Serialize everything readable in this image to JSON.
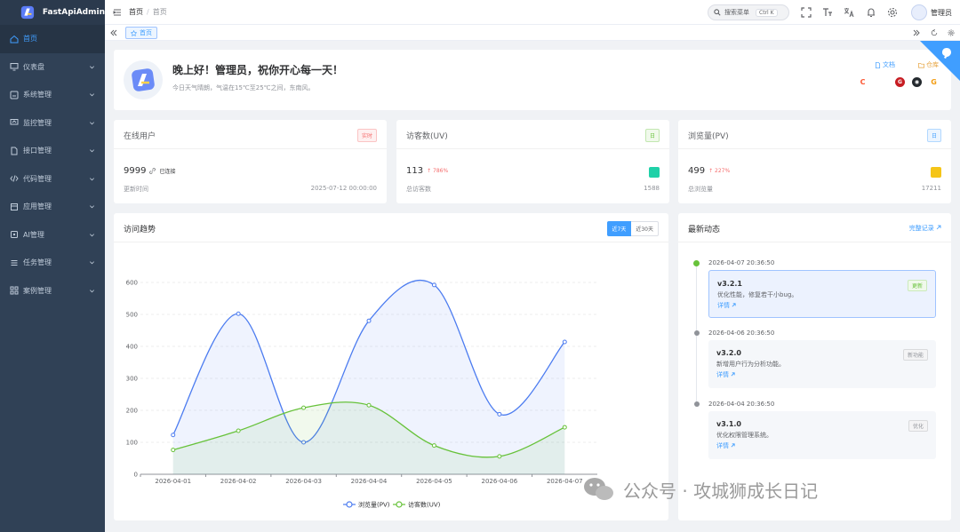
{
  "app": {
    "name": "FastApiAdmin"
  },
  "sidebar": {
    "items": [
      {
        "label": "首页",
        "icon": "home-icon",
        "active": true
      },
      {
        "label": "仪表盘",
        "icon": "monitor-icon"
      },
      {
        "label": "系统管理",
        "icon": "system-icon"
      },
      {
        "label": "监控管理",
        "icon": "monitor-chart-icon"
      },
      {
        "label": "接口管理",
        "icon": "api-doc-icon"
      },
      {
        "label": "代码管理",
        "icon": "code-icon"
      },
      {
        "label": "应用管理",
        "icon": "app-icon"
      },
      {
        "label": "AI管理",
        "icon": "ai-icon"
      },
      {
        "label": "任务管理",
        "icon": "task-icon"
      },
      {
        "label": "案例管理",
        "icon": "grid-icon"
      }
    ]
  },
  "header": {
    "breadcrumb": [
      "首页",
      "首页"
    ],
    "breadcrumb_sep": "/",
    "search_placeholder": "搜索菜单",
    "shortcut": "Ctrl K",
    "user_name": "管理员"
  },
  "tabs": [
    {
      "label": "首页"
    }
  ],
  "welcome": {
    "title": "晚上好！管理员，祝你开心每一天！",
    "subtitle": "今日天气晴朗，气温在15℃至25℃之间，东南风。",
    "doc_link": "文档",
    "repo_link": "仓库"
  },
  "stats": [
    {
      "title": "在线用户",
      "badge": "实时",
      "badge_color": "#f56c6c",
      "value": "9999",
      "extra": "已连接",
      "foot_label": "更新时间",
      "foot_value": "2025-07-12 00:00:00"
    },
    {
      "title": "访客数(UV)",
      "badge": "日",
      "badge_color": "#67c23a",
      "value": "113",
      "extra": "↑ 786%",
      "foot_label": "总访客数",
      "foot_value": "1588"
    },
    {
      "title": "浏览量(PV)",
      "badge": "日",
      "badge_color": "#409eff",
      "value": "499",
      "extra": "↑ 227%",
      "foot_label": "总浏览量",
      "foot_value": "17211"
    }
  ],
  "trend": {
    "title": "访问趋势",
    "range_options": [
      "近7天",
      "近30天"
    ],
    "selected": "近7天"
  },
  "chart_data": {
    "type": "line",
    "x": [
      "2026-04-01",
      "2026-04-02",
      "2026-04-03",
      "2026-04-04",
      "2026-04-05",
      "2026-04-06",
      "2026-04-07"
    ],
    "series": [
      {
        "name": "浏览量(PV)",
        "values": [
          123,
          502,
          100,
          480,
          592,
          188,
          414
        ],
        "color": "#4c7cf0"
      },
      {
        "name": "访客数(UV)",
        "values": [
          76,
          136,
          208,
          216,
          90,
          56,
          147
        ],
        "color": "#67c23a"
      }
    ],
    "ylim": [
      0,
      600
    ],
    "yticks": [
      0,
      100,
      200,
      300,
      400,
      500,
      600
    ],
    "smooth": true,
    "area": true,
    "grid": true,
    "legend": "bottom"
  },
  "news": {
    "title": "最新动态",
    "more": "完整记录",
    "items": [
      {
        "date": "2026-04-07 20:36:50",
        "version": "v3.2.1",
        "desc": "优化性能，修复若干小bug。",
        "link": "详情",
        "badge": "更新",
        "dot_color": "#67c23a",
        "highlight": true
      },
      {
        "date": "2026-04-06 20:36:50",
        "version": "v3.2.0",
        "desc": "新增用户行为分析功能。",
        "link": "详情",
        "badge": "新功能",
        "dot_color": "#909399"
      },
      {
        "date": "2026-04-04 20:36:50",
        "version": "v3.1.0",
        "desc": "优化权限管理系统。",
        "link": "详情",
        "badge": "优化",
        "dot_color": "#909399"
      }
    ]
  },
  "watermark": {
    "text": "公众号 · 攻城狮成长日记"
  }
}
